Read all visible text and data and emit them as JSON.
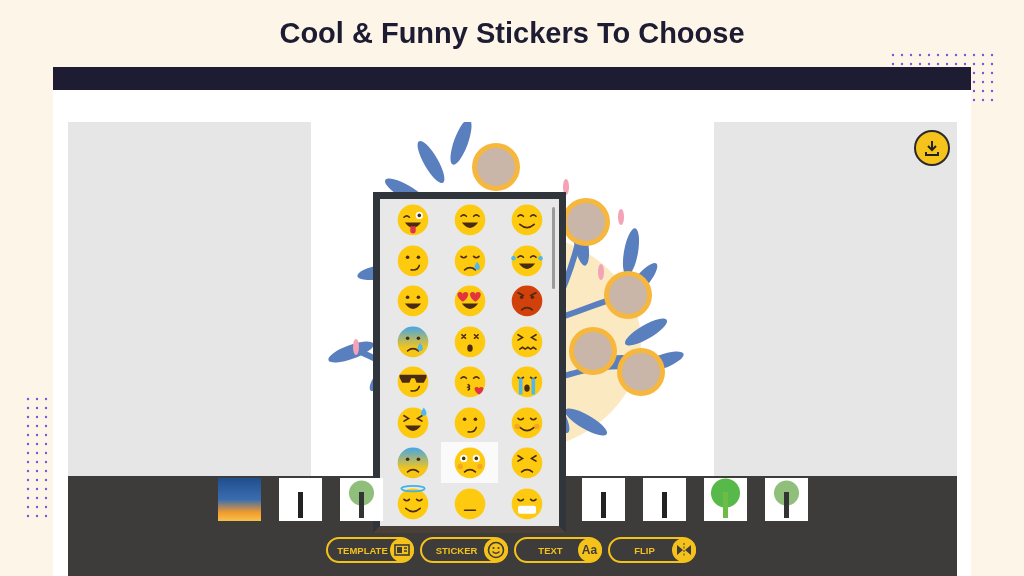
{
  "heading": "Cool & Funny Stickers To Choose",
  "sticker_panel": {
    "stickers": [
      {
        "kind": "wink",
        "selected": false
      },
      {
        "kind": "grin",
        "selected": false
      },
      {
        "kind": "smile",
        "selected": false
      },
      {
        "kind": "smirk",
        "selected": false
      },
      {
        "kind": "sleepy",
        "selected": false
      },
      {
        "kind": "laugh",
        "selected": false
      },
      {
        "kind": "happy",
        "selected": false
      },
      {
        "kind": "hearts",
        "selected": false
      },
      {
        "kind": "angry",
        "selected": false
      },
      {
        "kind": "anxious",
        "selected": false
      },
      {
        "kind": "dizzy",
        "selected": false
      },
      {
        "kind": "confounded",
        "selected": false
      },
      {
        "kind": "cool",
        "selected": false
      },
      {
        "kind": "kiss",
        "selected": false
      },
      {
        "kind": "sob",
        "selected": false
      },
      {
        "kind": "sweat",
        "selected": false
      },
      {
        "kind": "wry",
        "selected": false
      },
      {
        "kind": "blush",
        "selected": false
      },
      {
        "kind": "fearful",
        "selected": false
      },
      {
        "kind": "flushed",
        "selected": true
      },
      {
        "kind": "persevere",
        "selected": false
      },
      {
        "kind": "halo",
        "selected": false
      },
      {
        "kind": "neutral",
        "selected": false
      },
      {
        "kind": "mask",
        "selected": false
      }
    ]
  },
  "thumbnails_left": [
    {
      "kind": "sunset"
    },
    {
      "kind": "frames"
    },
    {
      "kind": "tree"
    }
  ],
  "thumbnails_right": [
    {
      "kind": "frames"
    },
    {
      "kind": "frames"
    },
    {
      "kind": "green"
    },
    {
      "kind": "tree"
    }
  ],
  "toolbar": [
    {
      "kind": "template",
      "label": "TEMPLATE"
    },
    {
      "kind": "sticker",
      "label": "STICKER"
    },
    {
      "kind": "text",
      "label": "TEXT",
      "icon_text": "Aa"
    },
    {
      "kind": "flip",
      "label": "FLIP"
    }
  ]
}
